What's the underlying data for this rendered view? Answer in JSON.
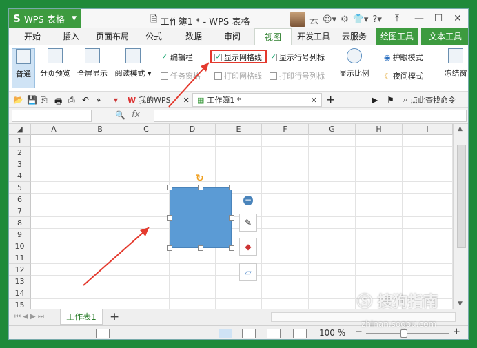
{
  "app": {
    "name": "WPS 表格",
    "logo_letter": "S",
    "doc_title": "工作簿1 * - WPS 表格",
    "user_label": "云"
  },
  "menu_tabs": [
    "开始",
    "插入",
    "页面布局",
    "公式",
    "数据",
    "审阅",
    "视图",
    "开发工具",
    "云服务",
    "绘图工具",
    "文本工具"
  ],
  "active_menu_tab": "视图",
  "ribbon": {
    "big_buttons": [
      {
        "label": "普通",
        "active": true
      },
      {
        "label": "分页预览",
        "active": false
      },
      {
        "label": "全屏显示",
        "active": false
      },
      {
        "label": "阅读模式 ▾",
        "active": false
      }
    ],
    "checks": [
      {
        "label": "编辑栏",
        "checked": true,
        "disabled": false
      },
      {
        "label": "显示网格线",
        "checked": true,
        "disabled": false
      },
      {
        "label": "显示行号列标",
        "checked": true,
        "disabled": false
      },
      {
        "label": "任务窗格",
        "checked": false,
        "disabled": true
      },
      {
        "label": "打印网格线",
        "checked": false,
        "disabled": true
      },
      {
        "label": "打印行号列标",
        "checked": false,
        "disabled": true
      }
    ],
    "zoom_label": "显示比例",
    "eye_mode": "护眼模式",
    "night_mode": "夜间模式",
    "freeze_label": "冻结窗"
  },
  "doc_tabs": {
    "my_wps": "我的WPS",
    "workbook": "工作簿1 *",
    "find_cmd": "点此查找命令"
  },
  "formula": {
    "fx": "fx"
  },
  "columns": [
    "A",
    "B",
    "C",
    "D",
    "E",
    "F",
    "G",
    "H",
    "I"
  ],
  "rows": [
    "1",
    "2",
    "3",
    "4",
    "5",
    "6",
    "7",
    "8",
    "9",
    "10",
    "11",
    "12",
    "13",
    "14",
    "15"
  ],
  "sheet_tab": "工作表1",
  "status": {
    "zoom": "100 %"
  },
  "watermark": {
    "brand": "搜狗指南",
    "url": "zhinan.sogou.com"
  },
  "colors": {
    "accent_green": "#3d9b3f",
    "shape_fill": "#5b9bd5",
    "highlight_red": "#e43a2e"
  }
}
